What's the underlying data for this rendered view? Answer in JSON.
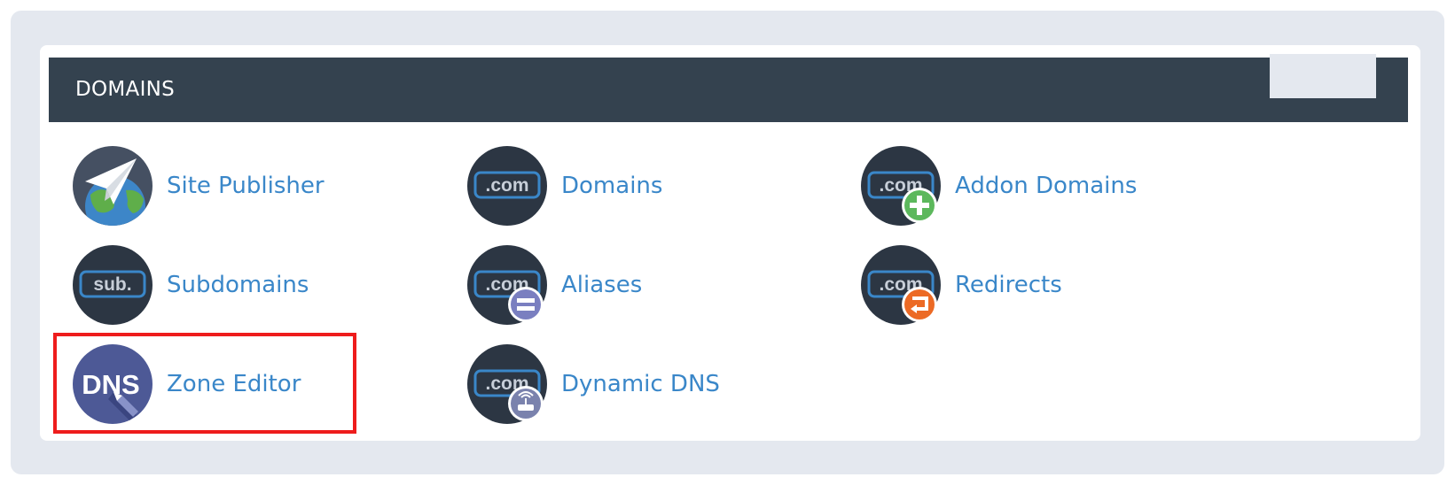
{
  "section": {
    "title": "DOMAINS"
  },
  "items": [
    {
      "label": "Site Publisher",
      "icon": "paper-plane-globe-icon"
    },
    {
      "label": "Domains",
      "icon": "dot-com-icon"
    },
    {
      "label": "Addon Domains",
      "icon": "dot-com-plus-icon"
    },
    {
      "label": "Subdomains",
      "icon": "sub-domain-icon"
    },
    {
      "label": "Aliases",
      "icon": "dot-com-equals-icon"
    },
    {
      "label": "Redirects",
      "icon": "dot-com-redirect-icon"
    },
    {
      "label": "Zone Editor",
      "icon": "dns-edit-icon"
    },
    {
      "label": "Dynamic DNS",
      "icon": "dot-com-router-icon"
    }
  ],
  "icon_text": {
    "com": ".com",
    "sub": "sub.",
    "dns": "DNS"
  },
  "colors": {
    "header_bg": "#34424f",
    "link": "#3a87c9",
    "icon_bg": "#2c3643",
    "highlight": "#ee1c1c",
    "plus_badge": "#5cb85c",
    "equals_badge": "#7a7fc0",
    "redirect_badge": "#ec6a25"
  }
}
